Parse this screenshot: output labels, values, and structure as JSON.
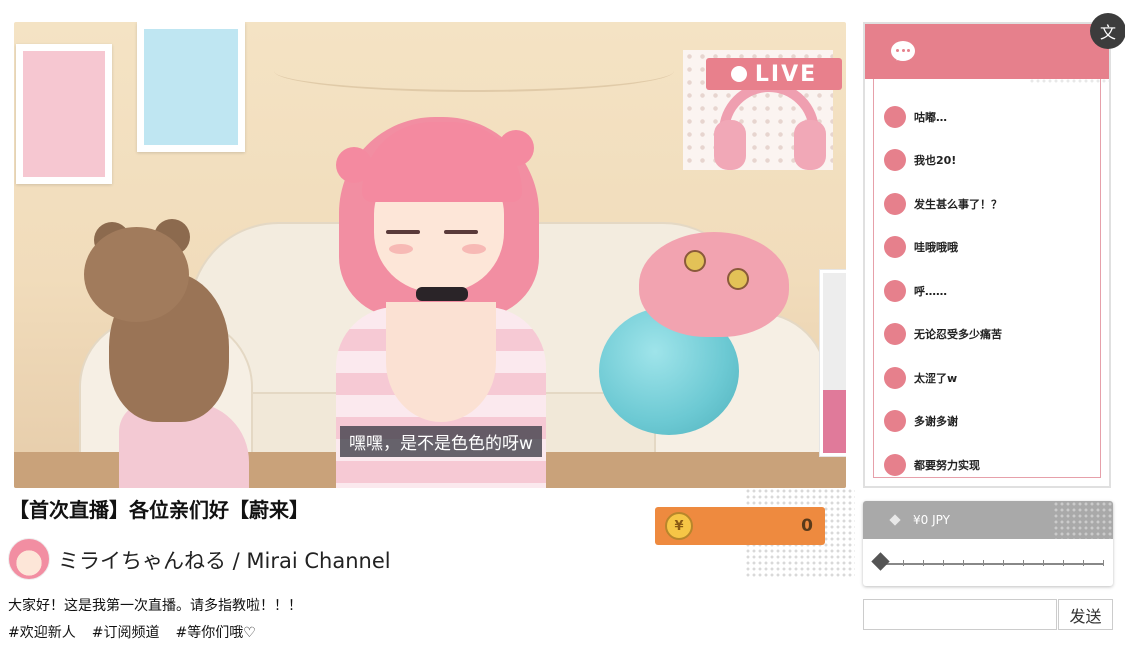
{
  "stream": {
    "live_label": "LIVE",
    "subtitle": "嘿嘿，是不是色色的呀w",
    "gauge_level_percent": 35
  },
  "info": {
    "title": "【首次直播】各位亲们好【蔚来】",
    "channel": "ミライちゃんねる / Mirai Channel",
    "description": "大家好！这是我第一次直播。请多指教啦！！！",
    "tags": [
      "#欢迎新人",
      "#订阅频道",
      "#等你们哦♡"
    ]
  },
  "coins": {
    "icon": "¥",
    "amount": "0"
  },
  "chat": {
    "messages": [
      "咕嘟…",
      "我也20!",
      "发生甚么事了！？",
      "哇哦哦哦",
      "呼……",
      "无论忍受多少痛苦",
      "太涩了w",
      "多谢多谢",
      "都要努力实现"
    ]
  },
  "donation": {
    "amount_label": "¥0 JPY",
    "slider_value": 0
  },
  "input": {
    "placeholder": "",
    "send_label": "发送"
  },
  "toolbar": {
    "translate_label": "文"
  },
  "colors": {
    "accent_pink": "#e6808c",
    "coin_orange": "#ee8a3f",
    "gauge_fill": "#e07a9a"
  }
}
